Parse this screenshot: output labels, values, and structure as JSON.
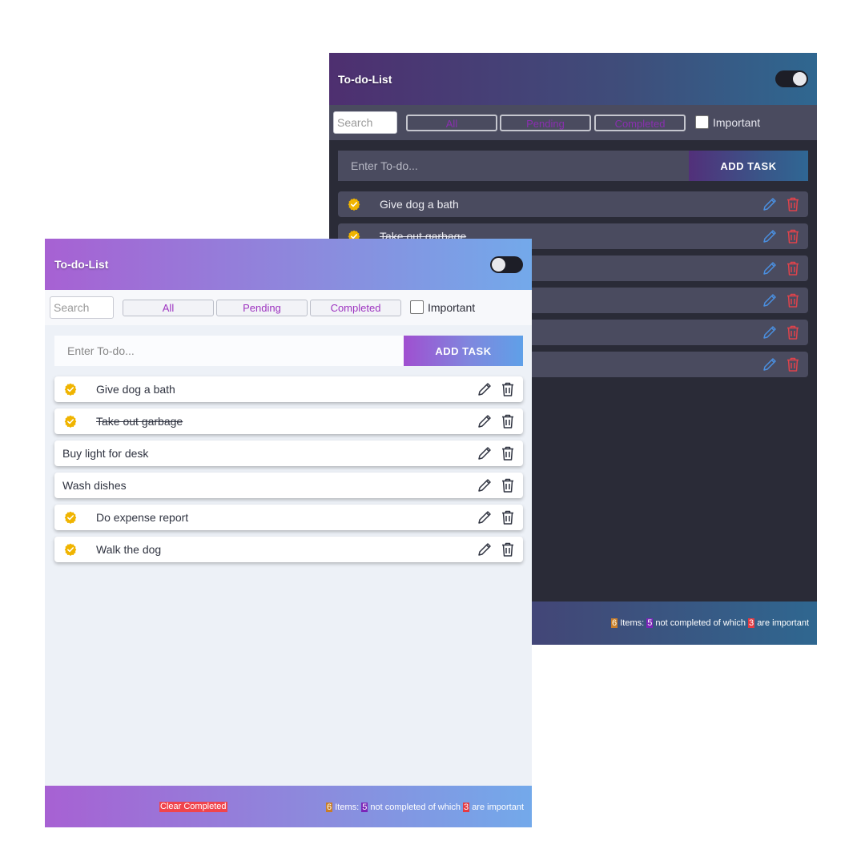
{
  "colors": {
    "important_badge": "#f0b400",
    "dark_edit_icon": "#4a8fe0",
    "dark_delete_icon": "#e0434b",
    "light_icon": "#2f3340",
    "accent_text": "#9d33c0",
    "clear_button_bg": "#f0444c"
  },
  "dark_app": {
    "title": "To-do-List",
    "search_placeholder": "Search",
    "filters": {
      "all": "All",
      "pending": "Pending",
      "completed": "Completed"
    },
    "important_label": "Important",
    "input_placeholder": "Enter To-do...",
    "add_button": "ADD TASK",
    "items": [
      {
        "text": "Give dog a bath",
        "important": true,
        "completed": false
      },
      {
        "text": "Take out garbage",
        "important": true,
        "completed": true
      },
      {
        "text": "",
        "important": false,
        "completed": false
      },
      {
        "text": "",
        "important": false,
        "completed": false
      },
      {
        "text": "",
        "important": false,
        "completed": false
      },
      {
        "text": "",
        "important": false,
        "completed": false
      }
    ],
    "footer": {
      "total": "6",
      "items_label": "Items:",
      "pending": "5",
      "pending_label": "not completed of which",
      "important": "3",
      "important_label": "are important"
    }
  },
  "light_app": {
    "title": "To-do-List",
    "search_placeholder": "Search",
    "filters": {
      "all": "All",
      "pending": "Pending",
      "completed": "Completed"
    },
    "important_label": "Important",
    "input_placeholder": "Enter To-do...",
    "add_button": "ADD TASK",
    "items": [
      {
        "text": "Give dog a bath",
        "important": true,
        "completed": false
      },
      {
        "text": "Take out garbage",
        "important": true,
        "completed": true
      },
      {
        "text": "Buy light for desk",
        "important": false,
        "completed": false
      },
      {
        "text": "Wash dishes",
        "important": false,
        "completed": false
      },
      {
        "text": "Do expense report",
        "important": true,
        "completed": false
      },
      {
        "text": "Walk the dog",
        "important": true,
        "completed": false
      }
    ],
    "footer": {
      "clear_button": "Clear Completed",
      "total": "6",
      "items_label": "Items:",
      "pending": "5",
      "pending_label": "not completed of which",
      "important": "3",
      "important_label": "are important"
    }
  }
}
